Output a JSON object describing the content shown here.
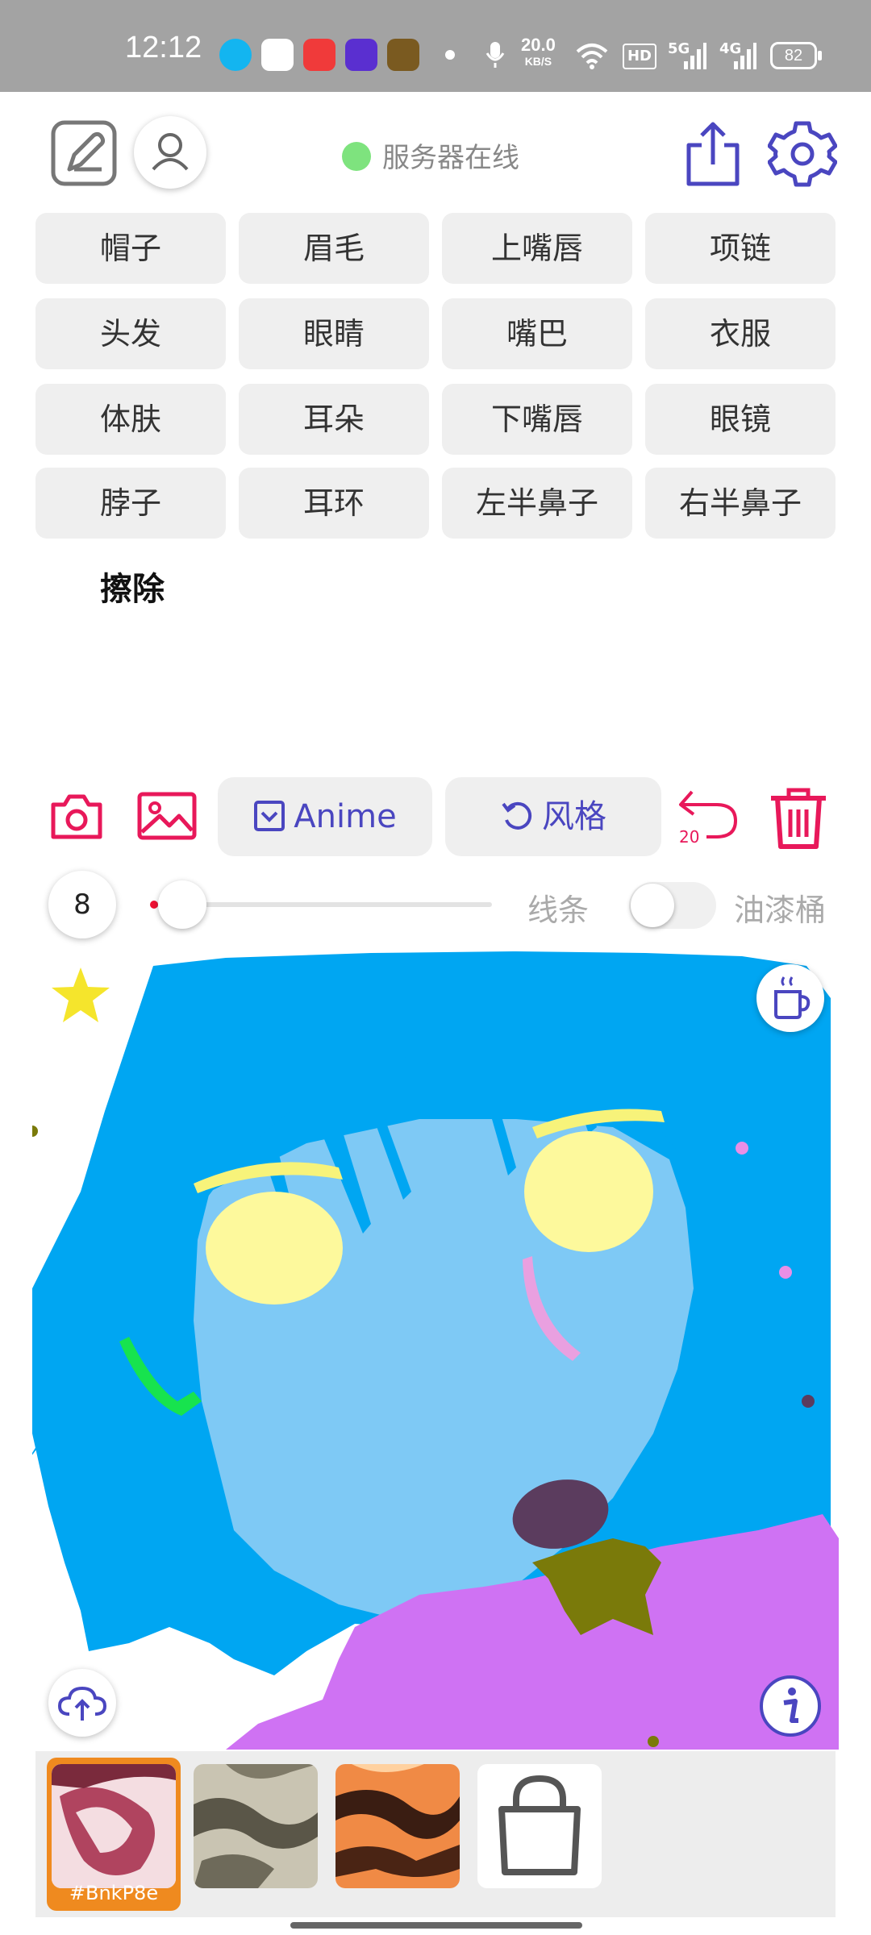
{
  "status_bar": {
    "time": "12:12",
    "net_speed_value": "20.0",
    "net_speed_unit": "KB/S",
    "signal_1": "5G",
    "signal_2": "4G",
    "hd_badge": "HD",
    "battery": "82"
  },
  "header": {
    "server_status": "服务器在线",
    "server_status_color": "#7ee37e",
    "icons": [
      "edit-icon",
      "user-icon",
      "share-icon",
      "settings-icon"
    ]
  },
  "parts": [
    "帽子",
    "眉毛",
    "上嘴唇",
    "项链",
    "头发",
    "眼睛",
    "嘴巴",
    "衣服",
    "体肤",
    "耳朵",
    "下嘴唇",
    "眼镜",
    "脖子",
    "耳环",
    "左半鼻子",
    "右半鼻子"
  ],
  "erase_label": "擦除",
  "toolbar": {
    "model_label": "Anime",
    "style_label": "风格",
    "undo_count": "20",
    "accent_color": "#e8185a",
    "secondary_color": "#4a46c0"
  },
  "brush": {
    "size": "8",
    "slider_fraction": 0.02,
    "mode_label": "线条",
    "bucket_label": "油漆桶",
    "bucket_enabled": false
  },
  "styles": [
    {
      "code": "#BnkP8e",
      "selected": true
    },
    {
      "code": "",
      "selected": false
    },
    {
      "code": "",
      "selected": false
    }
  ],
  "store_icon": "shopping-bag-icon"
}
